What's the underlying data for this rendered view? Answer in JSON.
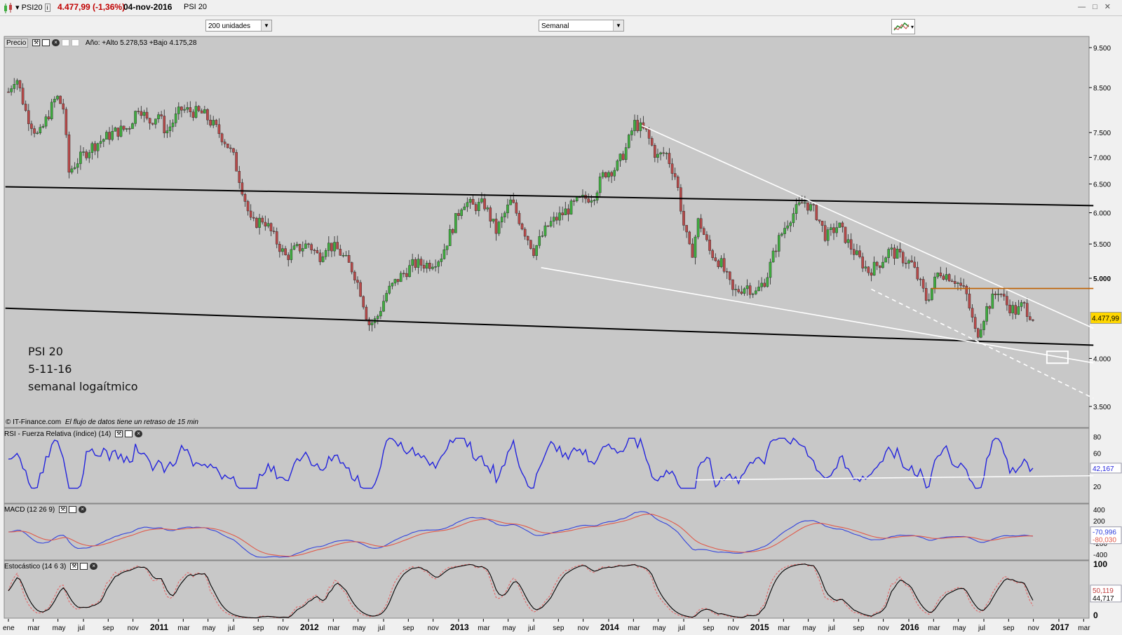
{
  "header": {
    "symbol": "PSI20",
    "price": "4.477,99 (-1,36%)",
    "date": "04-nov-2016",
    "name": "PSI 20"
  },
  "toolbar": {
    "units": "200 unidades",
    "period": "Semanal"
  },
  "price_panel": {
    "label": "Precio",
    "year_stats": "Año: +Alto 5.278,53 +Bajo 4.175,28",
    "credit_brand": "© IT-Finance.com",
    "credit_note": "El flujo de datos tiene un retraso de 15 min",
    "annotation": [
      "PSI 20",
      "5-11-16",
      "semanal logaítmico"
    ],
    "last_label": "4.477,99",
    "y_ticks": [
      "9.500",
      "8.500",
      "7.500",
      "7.000",
      "6.500",
      "6.000",
      "5.500",
      "5.000",
      "4.000",
      "3.500"
    ]
  },
  "rsi_panel": {
    "label": "RSI - Fuerza Relativa (índice) (14)",
    "y_ticks": [
      "80",
      "60",
      "40",
      "20"
    ],
    "last_label": "42,167"
  },
  "macd_panel": {
    "label": "MACD (12 26 9)",
    "y_ticks": [
      "400",
      "200",
      "-200",
      "-400"
    ],
    "macd_label": "-70,996",
    "signal_label": "-80,030"
  },
  "stoch_panel": {
    "label": "Estocástico (14 6 3)",
    "y_ticks": [
      "100",
      "0"
    ],
    "k_label": "50,119",
    "d_label": "44,717"
  },
  "x_axis": [
    {
      "t": 0.0,
      "label": "ene",
      "bold": false
    },
    {
      "t": 0.165,
      "label": "mar",
      "bold": false
    },
    {
      "t": 0.33,
      "label": "may",
      "bold": false
    },
    {
      "t": 0.5,
      "label": "jul",
      "bold": false
    },
    {
      "t": 0.665,
      "label": "sep",
      "bold": false
    },
    {
      "t": 0.83,
      "label": "nov",
      "bold": false
    },
    {
      "t": 1.0,
      "label": "2011",
      "bold": true
    },
    {
      "t": 1.165,
      "label": "mar",
      "bold": false
    },
    {
      "t": 1.33,
      "label": "may",
      "bold": false
    },
    {
      "t": 1.5,
      "label": "jul",
      "bold": false
    },
    {
      "t": 1.665,
      "label": "sep",
      "bold": false
    },
    {
      "t": 1.83,
      "label": "nov",
      "bold": false
    },
    {
      "t": 2.0,
      "label": "2012",
      "bold": true
    },
    {
      "t": 2.165,
      "label": "mar",
      "bold": false
    },
    {
      "t": 2.33,
      "label": "may",
      "bold": false
    },
    {
      "t": 2.5,
      "label": "jul",
      "bold": false
    },
    {
      "t": 2.665,
      "label": "sep",
      "bold": false
    },
    {
      "t": 2.83,
      "label": "nov",
      "bold": false
    },
    {
      "t": 3.0,
      "label": "2013",
      "bold": true
    },
    {
      "t": 3.165,
      "label": "mar",
      "bold": false
    },
    {
      "t": 3.33,
      "label": "may",
      "bold": false
    },
    {
      "t": 3.5,
      "label": "jul",
      "bold": false
    },
    {
      "t": 3.665,
      "label": "sep",
      "bold": false
    },
    {
      "t": 3.83,
      "label": "nov",
      "bold": false
    },
    {
      "t": 4.0,
      "label": "2014",
      "bold": true
    },
    {
      "t": 4.165,
      "label": "mar",
      "bold": false
    },
    {
      "t": 4.33,
      "label": "may",
      "bold": false
    },
    {
      "t": 4.5,
      "label": "jul",
      "bold": false
    },
    {
      "t": 4.665,
      "label": "sep",
      "bold": false
    },
    {
      "t": 4.83,
      "label": "nov",
      "bold": false
    },
    {
      "t": 5.0,
      "label": "2015",
      "bold": true
    },
    {
      "t": 5.165,
      "label": "mar",
      "bold": false
    },
    {
      "t": 5.33,
      "label": "may",
      "bold": false
    },
    {
      "t": 5.5,
      "label": "jul",
      "bold": false
    },
    {
      "t": 5.665,
      "label": "sep",
      "bold": false
    },
    {
      "t": 5.83,
      "label": "nov",
      "bold": false
    },
    {
      "t": 6.0,
      "label": "2016",
      "bold": true
    },
    {
      "t": 6.165,
      "label": "mar",
      "bold": false
    },
    {
      "t": 6.33,
      "label": "may",
      "bold": false
    },
    {
      "t": 6.5,
      "label": "jul",
      "bold": false
    },
    {
      "t": 6.665,
      "label": "sep",
      "bold": false
    },
    {
      "t": 6.83,
      "label": "nov",
      "bold": false
    },
    {
      "t": 7.0,
      "label": "2017",
      "bold": true
    },
    {
      "t": 7.165,
      "label": "mar",
      "bold": false
    }
  ],
  "colors": {
    "bg": "#c8c8c8",
    "up": "#3fae3f",
    "down": "#b84a4a",
    "rsi": "#2323dd",
    "macd": "#3344dd",
    "signal": "#e05a4a",
    "stoch_k": "#000000",
    "stoch_d": "#e07070",
    "trend_black": "#000000",
    "trend_white": "#ffffff",
    "resistance": "#c06000",
    "last_bg": "#ffd700"
  },
  "chart_data": {
    "type": "candlestick",
    "timeframe": "weekly",
    "scale": "log",
    "x_range": [
      "2010-01",
      "2017-03"
    ],
    "y_range": [
      3300,
      9800
    ],
    "close_path": [
      [
        0.0,
        8400
      ],
      [
        0.05,
        8800
      ],
      [
        0.12,
        7900
      ],
      [
        0.2,
        7400
      ],
      [
        0.32,
        8300
      ],
      [
        0.37,
        8000
      ],
      [
        0.4,
        6700
      ],
      [
        0.45,
        6900
      ],
      [
        0.55,
        7200
      ],
      [
        0.7,
        7500
      ],
      [
        0.8,
        7600
      ],
      [
        0.87,
        8100
      ],
      [
        0.93,
        7700
      ],
      [
        1.0,
        7900
      ],
      [
        1.05,
        7500
      ],
      [
        1.15,
        8000
      ],
      [
        1.3,
        7900
      ],
      [
        1.38,
        7600
      ],
      [
        1.45,
        7300
      ],
      [
        1.5,
        7000
      ],
      [
        1.56,
        6400
      ],
      [
        1.62,
        5800
      ],
      [
        1.7,
        5900
      ],
      [
        1.77,
        5600
      ],
      [
        1.85,
        5300
      ],
      [
        1.9,
        5400
      ],
      [
        2.0,
        5500
      ],
      [
        2.07,
        5300
      ],
      [
        2.12,
        5500
      ],
      [
        2.2,
        5400
      ],
      [
        2.3,
        5100
      ],
      [
        2.35,
        4800
      ],
      [
        2.4,
        4400
      ],
      [
        2.45,
        4450
      ],
      [
        2.52,
        4800
      ],
      [
        2.6,
        5000
      ],
      [
        2.7,
        5200
      ],
      [
        2.8,
        5200
      ],
      [
        2.88,
        5300
      ],
      [
        2.95,
        5700
      ],
      [
        3.03,
        6200
      ],
      [
        3.1,
        6100
      ],
      [
        3.17,
        6150
      ],
      [
        3.25,
        5700
      ],
      [
        3.35,
        6200
      ],
      [
        3.42,
        5800
      ],
      [
        3.5,
        5400
      ],
      [
        3.6,
        5800
      ],
      [
        3.7,
        6000
      ],
      [
        3.8,
        6200
      ],
      [
        3.9,
        6300
      ],
      [
        3.97,
        6700
      ],
      [
        4.05,
        6800
      ],
      [
        4.12,
        7200
      ],
      [
        4.17,
        7700
      ],
      [
        4.25,
        7500
      ],
      [
        4.32,
        7000
      ],
      [
        4.38,
        7100
      ],
      [
        4.45,
        6600
      ],
      [
        4.5,
        5800
      ],
      [
        4.55,
        5300
      ],
      [
        4.6,
        5900
      ],
      [
        4.67,
        5400
      ],
      [
        4.75,
        5200
      ],
      [
        4.83,
        4800
      ],
      [
        4.92,
        4900
      ],
      [
        4.98,
        4800
      ],
      [
        5.05,
        5000
      ],
      [
        5.12,
        5500
      ],
      [
        5.2,
        5900
      ],
      [
        5.3,
        6200
      ],
      [
        5.38,
        6000
      ],
      [
        5.45,
        5600
      ],
      [
        5.53,
        5800
      ],
      [
        5.6,
        5500
      ],
      [
        5.66,
        5300
      ],
      [
        5.73,
        5100
      ],
      [
        5.8,
        5200
      ],
      [
        5.87,
        5400
      ],
      [
        5.95,
        5300
      ],
      [
        6.02,
        5200
      ],
      [
        6.08,
        4900
      ],
      [
        6.12,
        4700
      ],
      [
        6.2,
        5100
      ],
      [
        6.3,
        5000
      ],
      [
        6.38,
        4800
      ],
      [
        6.45,
        4250
      ],
      [
        6.52,
        4600
      ],
      [
        6.6,
        4850
      ],
      [
        6.65,
        4650
      ],
      [
        6.72,
        4550
      ],
      [
        6.76,
        4650
      ],
      [
        6.8,
        4540
      ],
      [
        6.84,
        4478
      ]
    ],
    "trendlines": [
      {
        "color": "black",
        "points": [
          [
            -0.02,
            6450
          ],
          [
            7.23,
            6120
          ]
        ]
      },
      {
        "color": "black",
        "points": [
          [
            -0.02,
            4600
          ],
          [
            7.23,
            4150
          ]
        ]
      },
      {
        "color": "white",
        "points": [
          [
            4.22,
            7650
          ],
          [
            7.23,
            4350
          ]
        ]
      },
      {
        "color": "white",
        "points": [
          [
            3.55,
            5150
          ],
          [
            7.23,
            3950
          ]
        ]
      },
      {
        "color": "white",
        "style": "dashed",
        "points": [
          [
            5.75,
            4850
          ],
          [
            7.23,
            3580
          ]
        ]
      },
      {
        "color": "orange",
        "points": [
          [
            6.15,
            4860
          ],
          [
            7.23,
            4860
          ]
        ]
      }
    ],
    "last_close": 4477.99,
    "year_high": 5278.53,
    "year_low": 4175.28,
    "indicators": {
      "rsi": {
        "period": 14,
        "last": 42.167,
        "range": [
          0,
          90
        ],
        "support_line": [
          [
            4.58,
            28
          ],
          [
            7.23,
            33
          ]
        ]
      },
      "macd": {
        "params": [
          12,
          26,
          9
        ],
        "macd_last": -70.996,
        "signal_last": -80.03,
        "range": [
          -500,
          500
        ]
      },
      "stochastic": {
        "params": [
          14,
          6,
          3
        ],
        "k_last": 50.119,
        "d_last": 44.717,
        "range": [
          0,
          105
        ]
      }
    }
  }
}
